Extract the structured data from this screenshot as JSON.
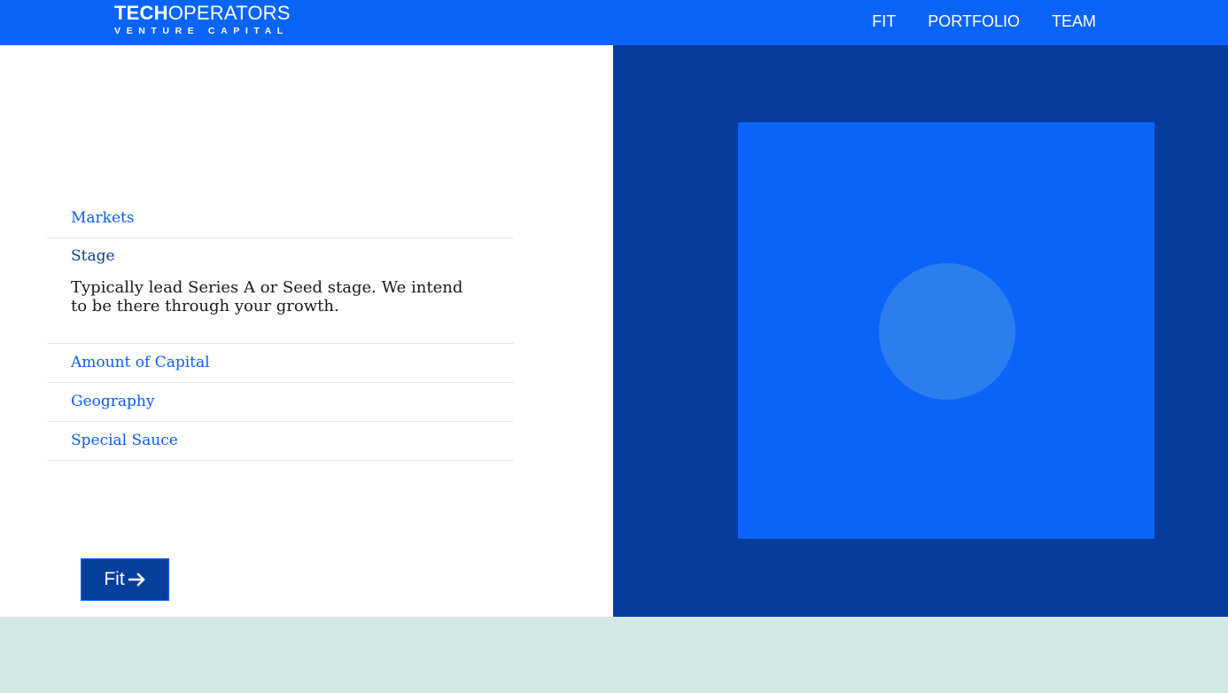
{
  "header": {
    "logo": {
      "bold": "TECH",
      "light": "OPERATORS",
      "tagline": "VENTURE CAPITAL"
    },
    "nav": [
      {
        "label": "FIT"
      },
      {
        "label": "PORTFOLIO"
      },
      {
        "label": "TEAM"
      }
    ]
  },
  "accordion": {
    "items": [
      {
        "title": "Markets"
      },
      {
        "title": "Stage",
        "body": "Typically lead Series A or Seed stage. We intend to be there through your growth."
      },
      {
        "title": "Amount of Capital"
      },
      {
        "title": "Geography"
      },
      {
        "title": "Special Sauce"
      }
    ]
  },
  "fit_button": {
    "label": "Fit"
  },
  "colors": {
    "brand_blue": "#0a64fa",
    "navy": "#063c9b",
    "button_navy": "#073f9c",
    "circle": "#2c7eef",
    "mint": "#d4e8e6"
  },
  "icons": {
    "fit_button_icon": "arrow-right-icon"
  }
}
